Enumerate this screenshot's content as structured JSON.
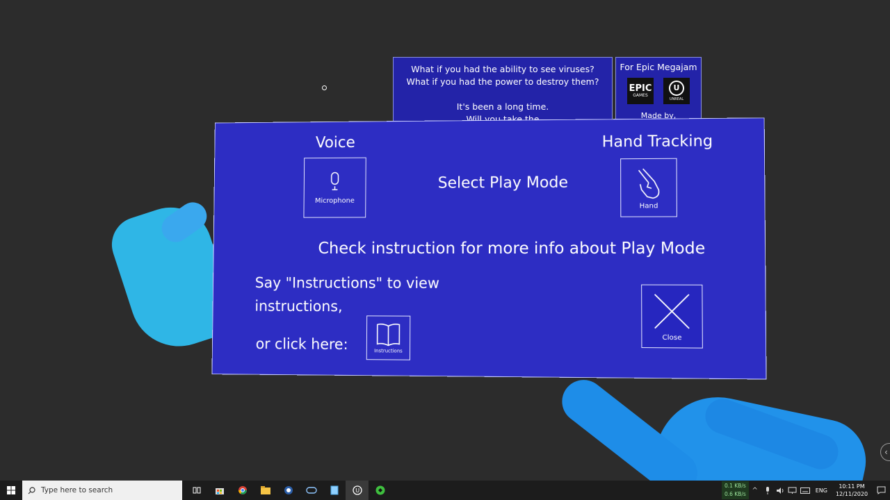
{
  "story_panel": {
    "lines": [
      "What if you had the ability to see viruses?",
      "What if you had the power to destroy them?",
      "",
      "It's been a long time.",
      "Will you take the"
    ]
  },
  "credit_panel": {
    "title": "For Epic Megajam",
    "logo_epic": "EPIC",
    "logo_epic_sub": "GAMES",
    "logo_ue": "U",
    "logo_ue_sub": "UNREAL",
    "made_by": "Made by,"
  },
  "main_panel": {
    "voice_title": "Voice",
    "hand_title": "Hand Tracking",
    "select_title": "Select Play Mode",
    "microphone_label": "Microphone",
    "hand_label": "Hand",
    "check_text": "Check instruction for more info about Play Mode",
    "say_text": "Say \"Instructions\" to view instructions,",
    "or_text": "or click here:",
    "instructions_label": "Instructions",
    "close_label": "Close"
  },
  "taskbar": {
    "search_placeholder": "Type here to search",
    "net_down": "0.1 KB/s",
    "net_up": "0.6 KB/s",
    "language": "ENG",
    "time": "10:11 PM",
    "date": "12/11/2020",
    "apps": [
      "task-view-icon",
      "store-icon",
      "chrome-icon",
      "file-explorer-icon",
      "app-icon",
      "vr-headset-icon",
      "notepad-icon",
      "unreal-engine-icon",
      "green-app-icon"
    ]
  },
  "colors": {
    "panel": "#2d2dc3",
    "hands": "#2fb6e6",
    "background": "#2c2c2c"
  }
}
